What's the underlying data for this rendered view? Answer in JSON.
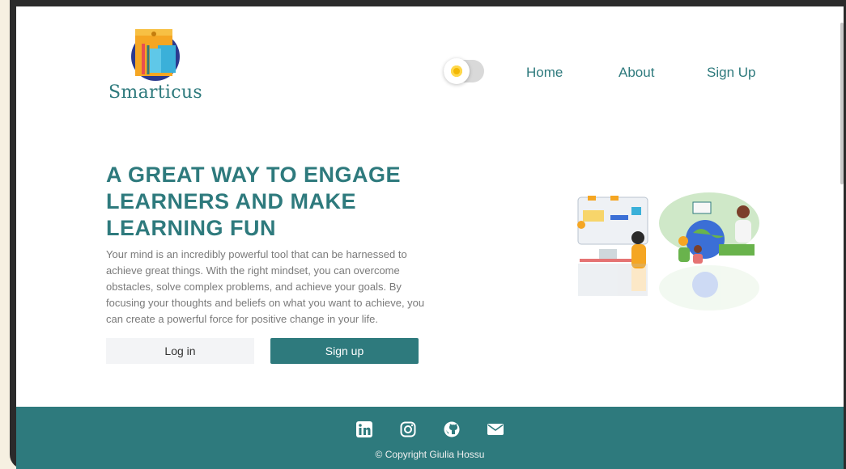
{
  "header": {
    "brand": "Smarticus",
    "nav": [
      {
        "label": "Home"
      },
      {
        "label": "About"
      },
      {
        "label": "Sign Up"
      }
    ],
    "theme_toggle_icon": "sun-icon"
  },
  "hero": {
    "headline": "A GREAT WAY TO ENGAGE LEARNERS AND MAKE LEARNING FUN",
    "body": "Your mind is an incredibly powerful tool that can be harnessed to achieve great things. With the right mindset, you can overcome obstacles, solve complex problems, and achieve your goals. By focusing your thoughts and beliefs on what you want to achieve, you can create a powerful force for positive change in your life.",
    "login_label": "Log in",
    "signup_label": "Sign up"
  },
  "footer": {
    "icons": [
      "linkedin-icon",
      "instagram-icon",
      "github-icon",
      "mail-icon"
    ],
    "copyright": "© Copyright Giulia Hossu"
  },
  "colors": {
    "accent": "#2e7a7d",
    "background": "#ffffff",
    "outer": "#f6f0e1"
  }
}
